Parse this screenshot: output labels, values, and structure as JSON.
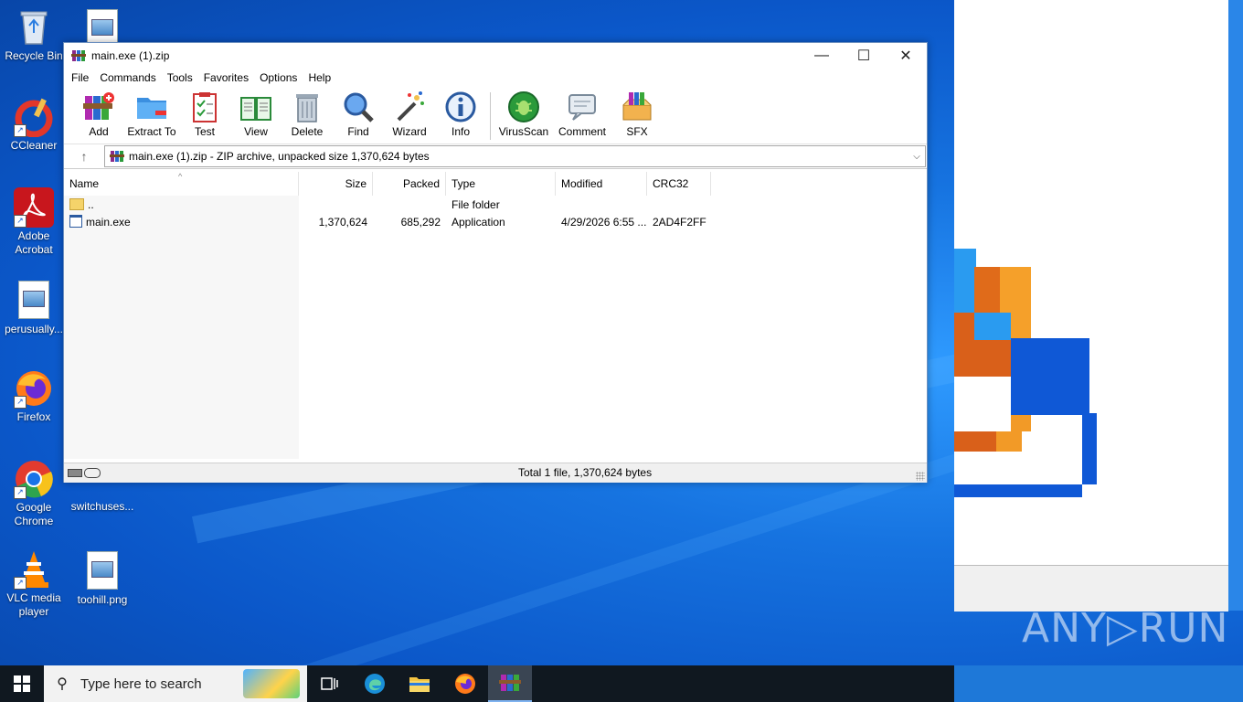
{
  "desktop": {
    "icons": [
      {
        "label": "Recycle Bin"
      },
      {
        "label": "CCleaner"
      },
      {
        "label": "Adobe Acrobat"
      },
      {
        "label": "perusually..."
      },
      {
        "label": "Firefox"
      },
      {
        "label": "Google Chrome"
      },
      {
        "label": "VLC media player"
      },
      {
        "label": "switchuses..."
      },
      {
        "label": "toohill.png"
      }
    ],
    "watermark": "ANY▷RUN"
  },
  "window": {
    "title": "main.exe (1).zip",
    "controls": {
      "minimize": "—",
      "maximize": "☐",
      "close": "✕"
    },
    "menu": [
      "File",
      "Commands",
      "Tools",
      "Favorites",
      "Options",
      "Help"
    ],
    "toolbar": [
      "Add",
      "Extract To",
      "Test",
      "View",
      "Delete",
      "Find",
      "Wizard",
      "Info",
      "VirusScan",
      "Comment",
      "SFX"
    ],
    "address": "main.exe (1).zip - ZIP archive, unpacked size 1,370,624 bytes",
    "columns": [
      "Name",
      "Size",
      "Packed",
      "Type",
      "Modified",
      "CRC32"
    ],
    "rows": [
      {
        "name": "..",
        "size": "",
        "packed": "",
        "type": "File folder",
        "modified": "",
        "crc": ""
      },
      {
        "name": "main.exe",
        "size": "1,370,624",
        "packed": "685,292",
        "type": "Application",
        "modified": "4/29/2026 6:55 ...",
        "crc": "2AD4F2FF"
      }
    ],
    "status": "Total 1 file, 1,370,624 bytes"
  },
  "taskbar": {
    "search_placeholder": "Type here to search"
  },
  "colors": {
    "accent": "#0078d7",
    "desktop": "#1673e0"
  }
}
